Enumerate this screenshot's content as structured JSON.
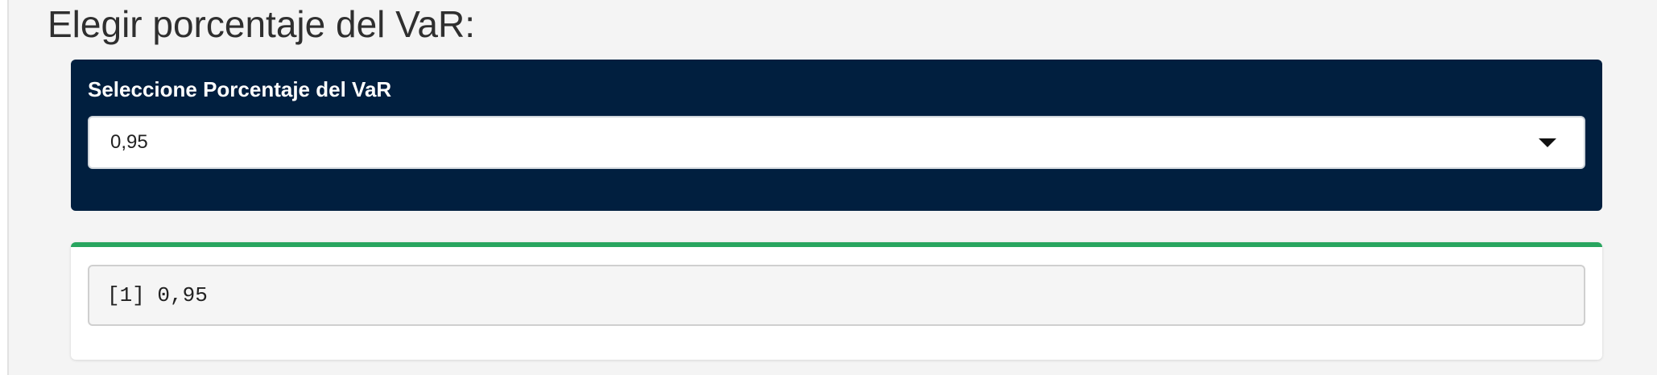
{
  "section": {
    "title": "Elegir porcentaje del VaR:"
  },
  "selector": {
    "label": "Seleccione Porcentaje del VaR",
    "selected_value": "0,95",
    "icon": "chevron-down-icon"
  },
  "output": {
    "text": "[1] 0,95"
  },
  "colors": {
    "selector_box_bg": "#011f3f",
    "output_box_accent": "#28a55f",
    "page_bg": "#f4f4f4"
  }
}
